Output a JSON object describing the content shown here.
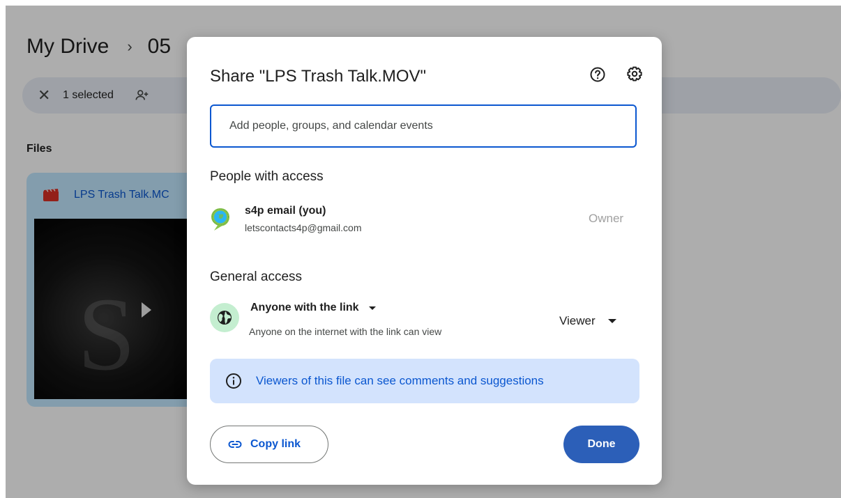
{
  "background": {
    "breadcrumb": {
      "root": "My Drive",
      "separator": "›",
      "current": "05"
    },
    "selection_bar": {
      "count_label": "1 selected"
    },
    "files_section_label": "Files",
    "file_card": {
      "name": "LPS Trash Talk.MC"
    }
  },
  "dialog": {
    "title": "Share \"LPS Trash Talk.MOV\"",
    "add_people_placeholder": "Add people, groups, and calendar events",
    "people_with_access_title": "People with access",
    "owner": {
      "name": "s4p email (you)",
      "email": "letscontacts4p@gmail.com",
      "role": "Owner"
    },
    "general_access_title": "General access",
    "general_access": {
      "scope": "Anyone with the link",
      "description": "Anyone on the internet with the link can view",
      "role": "Viewer"
    },
    "info_banner_text": "Viewers of this file can see comments and suggestions",
    "copy_link_label": "Copy link",
    "done_label": "Done"
  },
  "colors": {
    "accent_blue": "#0b57d0",
    "done_button": "#2c5fb8",
    "info_banner_bg": "#d3e3fd",
    "globe_bg": "#c4eed0",
    "selection_bar_bg": "#e9eef6",
    "file_card_bg": "#c2e7ff"
  }
}
